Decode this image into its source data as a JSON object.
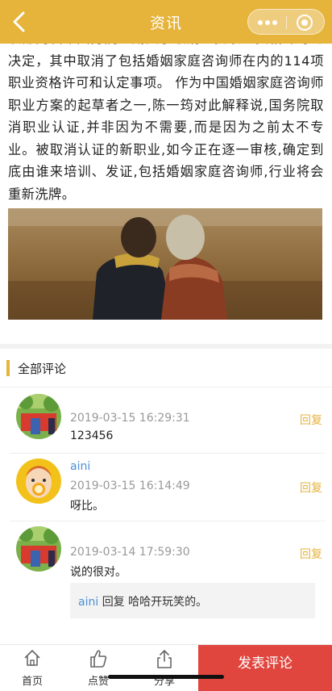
{
  "header": {
    "title": "资讯"
  },
  "article": {
    "text": "该部门发布国务院近期关于取消一批职业资格许可的决定，其中取消了包括婚姻家庭咨询师在内的114项职业资格许可和认定事项。 作为中国婚姻家庭咨询师职业方案的起草者之一,陈一筠对此解释说,国务院取消职业认证,并非因为不需要,而是因为之前太不专业。被取消认证的新职业,如今正在逐一审核,确定到底由谁来培训、发证,包括婚姻家庭咨询师,行业将会重新洗牌。"
  },
  "comments": {
    "title": "全部评论",
    "reply_label": "回复",
    "items": [
      {
        "user": "",
        "time": "2019-03-15 16:29:31",
        "text": "123456"
      },
      {
        "user": "aini",
        "time": "2019-03-15 16:14:49",
        "text": "呀比。"
      },
      {
        "user": "",
        "time": "2019-03-14 17:59:30",
        "text": "说的很对。",
        "sub_reply": {
          "name": "aini",
          "verb": "回复",
          "text": "哈哈开玩笑的。"
        }
      }
    ]
  },
  "bottom_bar": {
    "home": "首页",
    "like": "点赞",
    "share": "分享",
    "post": "发表评论"
  },
  "colors": {
    "accent": "#e6b33b",
    "post_button": "#e0453e",
    "username": "#4a90d9"
  },
  "icons": [
    "back-arrow-icon",
    "more-dots-icon",
    "close-circle-icon",
    "home-icon",
    "thumbs-up-icon",
    "share-icon"
  ]
}
